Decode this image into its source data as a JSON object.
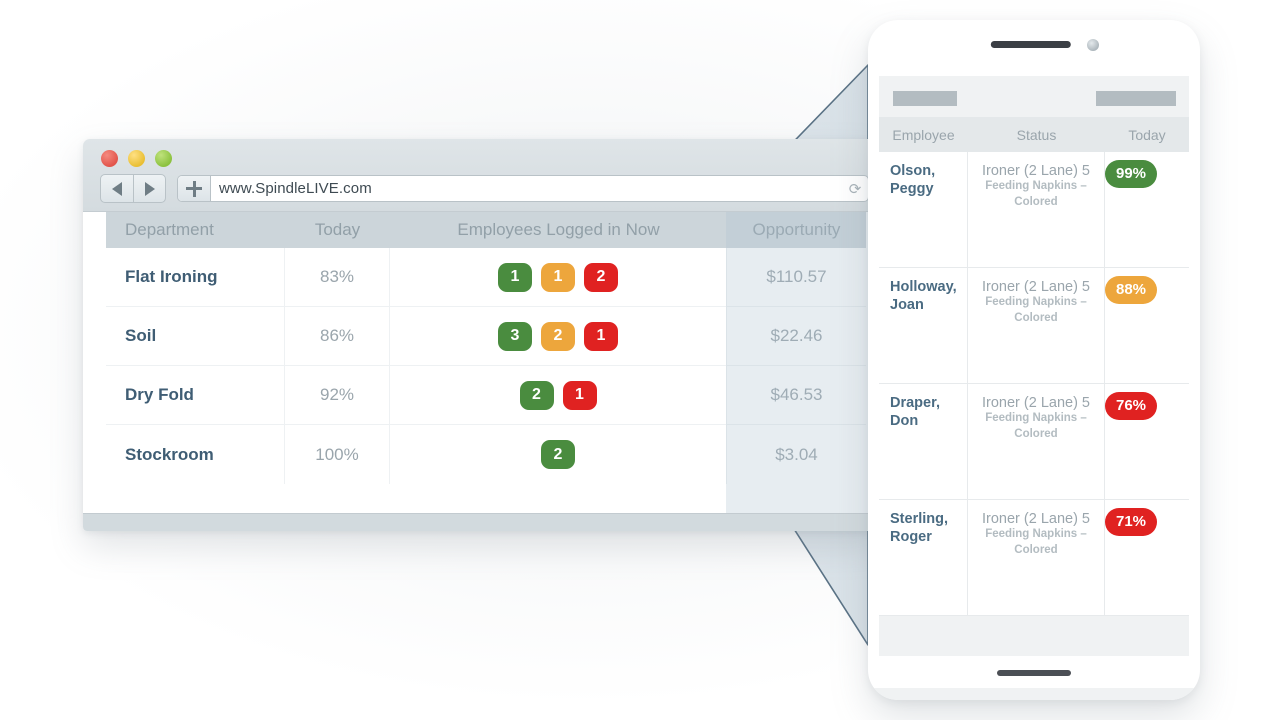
{
  "browser": {
    "window_controls": [
      "close-red",
      "minimize-yellow",
      "maximize-green"
    ],
    "back_label": "◀",
    "forward_label": "▶",
    "new_tab_label": "+",
    "url": "www.SpindleLIVE.com",
    "reload_glyph": "⟳"
  },
  "desktop_table": {
    "columns": [
      "Department",
      "Today",
      "Employees Logged in Now",
      "Opportunity"
    ],
    "rows": [
      {
        "department": "Flat Ironing",
        "today": "83%",
        "employees": [
          {
            "count": "1",
            "status": "green"
          },
          {
            "count": "1",
            "status": "orange"
          },
          {
            "count": "2",
            "status": "red"
          }
        ],
        "opportunity": "$110.57"
      },
      {
        "department": "Soil",
        "today": "86%",
        "employees": [
          {
            "count": "3",
            "status": "green"
          },
          {
            "count": "2",
            "status": "orange"
          },
          {
            "count": "1",
            "status": "red"
          }
        ],
        "opportunity": "$22.46"
      },
      {
        "department": "Dry Fold",
        "today": "92%",
        "employees": [
          {
            "count": "2",
            "status": "green"
          },
          {
            "count": "1",
            "status": "red"
          }
        ],
        "opportunity": "$46.53"
      },
      {
        "department": "Stockroom",
        "today": "100%",
        "employees": [
          {
            "count": "2",
            "status": "green"
          }
        ],
        "opportunity": "$3.04"
      }
    ]
  },
  "phone_table": {
    "columns": [
      "Employee",
      "Status",
      "Today"
    ],
    "rows": [
      {
        "employee": "Olson, Peggy",
        "status_line1": "Ironer (2 Lane) 5",
        "status_line2": "Feeding Napkins – Colored",
        "today": "99%",
        "today_status": "green"
      },
      {
        "employee": "Holloway, Joan",
        "status_line1": "Ironer (2 Lane) 5",
        "status_line2": "Feeding Napkins – Colored",
        "today": "88%",
        "today_status": "orange"
      },
      {
        "employee": "Draper, Don",
        "status_line1": "Ironer (2 Lane) 5",
        "status_line2": "Feeding Napkins – Colored",
        "today": "76%",
        "today_status": "red"
      },
      {
        "employee": "Sterling, Roger",
        "status_line1": "Ironer (2 Lane) 5",
        "status_line2": "Feeding Napkins – Colored",
        "today": "71%",
        "today_status": "red"
      }
    ]
  },
  "colors": {
    "green": "#4a8c3f",
    "orange": "#eda63c",
    "red": "#e02221",
    "header_grey": "#ccd5da",
    "dept_text": "#3f5d74",
    "muted_text": "#9aa5ac",
    "connector_stroke": "#5a7285",
    "connector_fill": "#ccd8e1"
  }
}
